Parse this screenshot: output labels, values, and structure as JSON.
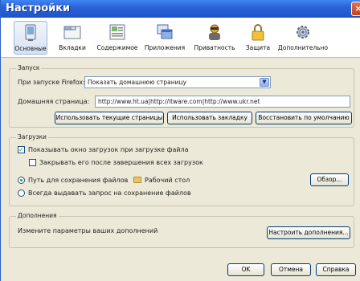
{
  "window": {
    "title": "Настройки",
    "close_glyph": "×"
  },
  "tabs": [
    {
      "label": "Основные",
      "icon": "general-icon",
      "selected": true
    },
    {
      "label": "Вкладки",
      "icon": "tabs-icon"
    },
    {
      "label": "Содержимое",
      "icon": "content-icon"
    },
    {
      "label": "Приложения",
      "icon": "applications-icon"
    },
    {
      "label": "Приватность",
      "icon": "privacy-icon"
    },
    {
      "label": "Защита",
      "icon": "lock-icon"
    },
    {
      "label": "Дополнительно",
      "icon": "gear-icon"
    }
  ],
  "startup": {
    "legend": "Запуск",
    "on_start_label": "При запуске Firefox:",
    "on_start_value": "Показать домашнюю страницу",
    "homepage_label": "Домашняя страница:",
    "homepage_value": "http://www.ht.ua|http://itware.com|http://www.ukr.net",
    "use_current_label": "Использовать текущие страницы",
    "use_bookmark_label": "Использовать закладку",
    "restore_default_label": "Восстановить по умолчанию"
  },
  "downloads": {
    "legend": "Загрузки",
    "show_window_label": "Показывать окно загрузок при загрузке файла",
    "show_window_checked": true,
    "close_when_done_label": "Закрывать его после завершения всех загрузок",
    "close_when_done_checked": false,
    "save_path_label": "Путь для сохранения файлов",
    "save_path_value": "Рабочий стол",
    "browse_label": "Обзор...",
    "always_ask_label": "Всегда выдавать запрос на сохранение файлов"
  },
  "addons": {
    "legend": "Дополнения",
    "description": "Измените параметры ваших дополнений",
    "manage_label": "Настроить дополнения..."
  },
  "footer": {
    "ok_label": "OK",
    "cancel_label": "Отмена",
    "help_label": "Справка"
  },
  "colors": {
    "titlebar": "#2b63d8",
    "window_bg": "#ece9d8",
    "accent_check": "#21a121"
  }
}
